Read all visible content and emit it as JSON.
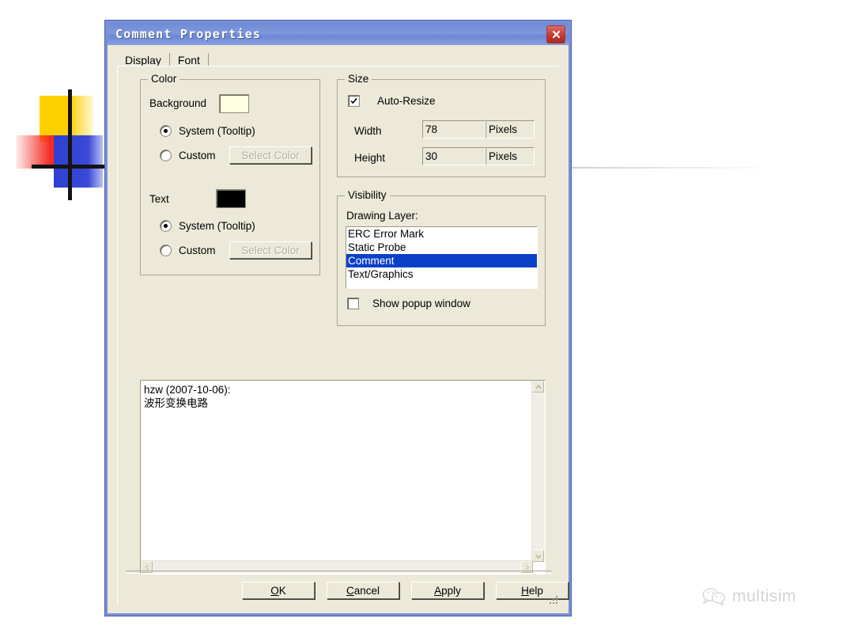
{
  "window": {
    "title": "Comment Properties",
    "close_icon": "close-x-icon"
  },
  "tabs": [
    {
      "label": "Display",
      "active": true
    },
    {
      "label": "Font",
      "active": false
    }
  ],
  "color_group": {
    "title": "Color",
    "background_label": "Background",
    "background_swatch_color": "#FFFFE1",
    "background_system_radio": "System (Tooltip)",
    "background_custom_radio": "Custom",
    "background_select_color_button": "Select Color",
    "text_label": "Text",
    "text_swatch_color": "#000000",
    "text_system_radio": "System (Tooltip)",
    "text_custom_radio": "Custom",
    "text_select_color_button": "Select Color"
  },
  "size_group": {
    "title": "Size",
    "auto_resize_label": "Auto-Resize",
    "auto_resize_checked": true,
    "width_label": "Width",
    "width_value": "78",
    "width_units": "Pixels",
    "height_label": "Height",
    "height_value": "30",
    "height_units": "Pixels"
  },
  "visibility_group": {
    "title": "Visibility",
    "drawing_layer_label": "Drawing Layer:",
    "layers": [
      {
        "label": "ERC Error Mark",
        "selected": false
      },
      {
        "label": "Static Probe",
        "selected": false
      },
      {
        "label": "Comment",
        "selected": true
      },
      {
        "label": "Text/Graphics",
        "selected": false
      }
    ],
    "show_popup_label": "Show popup window",
    "show_popup_checked": false
  },
  "comment": {
    "line1": "hzw (2007-10-06):",
    "line2": "波形变换电路",
    "text": "hzw (2007-10-06):\n波形变换电路"
  },
  "footer_buttons": [
    {
      "label": "OK",
      "accel": "O"
    },
    {
      "label": "Cancel",
      "accel": "C"
    },
    {
      "label": "Apply",
      "accel": "A"
    },
    {
      "label": "Help",
      "accel": "H"
    }
  ],
  "watermark": {
    "text": "multisim",
    "icon": "wechat-bubble-icon"
  },
  "colors": {
    "dialog_face": "#ECE9D8",
    "title_blue": "#7F98DD",
    "selection_blue": "#0A40C8",
    "close_red": "#C23B34",
    "border_blue": "#7B8FD4"
  }
}
